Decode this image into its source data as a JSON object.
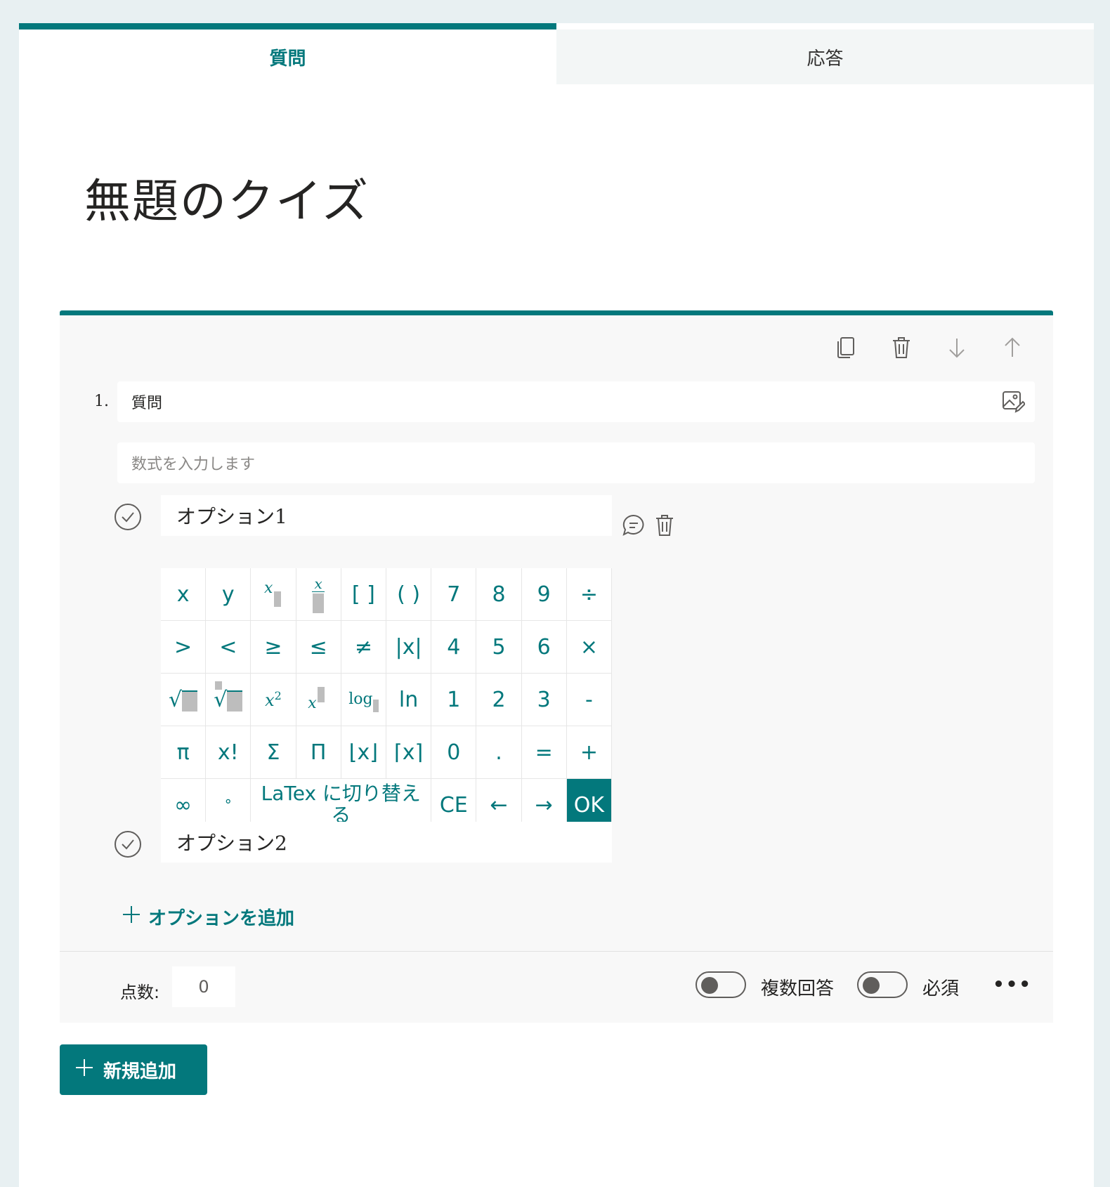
{
  "tabs": {
    "questions": "質問",
    "responses": "応答"
  },
  "form": {
    "title": "無題のクイズ"
  },
  "question": {
    "number": "1.",
    "text": "質問",
    "formula_placeholder": "数式を入力します"
  },
  "toolbar": {
    "copy_icon": "copy-icon",
    "delete_icon": "trash-icon",
    "down_icon": "arrow-down-icon",
    "up_icon": "arrow-up-icon"
  },
  "options": [
    {
      "label": "オプション1"
    },
    {
      "label": "オプション2"
    }
  ],
  "keypad": {
    "row1": [
      "x",
      "y",
      "",
      "",
      "[ ]",
      "( )",
      "7",
      "8",
      "9",
      "÷"
    ],
    "row2": [
      ">",
      "<",
      "≥",
      "≤",
      "≠",
      "|x|",
      "4",
      "5",
      "6",
      "×"
    ],
    "row3": [
      "",
      "",
      "",
      "",
      "log",
      "ln",
      "1",
      "2",
      "3",
      "-"
    ],
    "row4": [
      "π",
      "x!",
      "Σ",
      "Π",
      "⌊x⌋",
      "⌈x⌉",
      "0",
      ".",
      "=",
      "+"
    ],
    "row5": {
      "inf": "∞",
      "degree": "°",
      "latex": "LaTex に切り替える",
      "ce": "CE",
      "left": "←",
      "right": "→",
      "ok": "OK"
    }
  },
  "add_option": "オプションを追加",
  "footer": {
    "score_label": "点数:",
    "score_value": "0",
    "multiple_label": "複数回答",
    "required_label": "必須",
    "more": "•••"
  },
  "new_button": "新規追加",
  "colors": {
    "accent": "#03787c",
    "card_bg": "#f8f8f8",
    "page_bg": "#e8f0f2"
  }
}
